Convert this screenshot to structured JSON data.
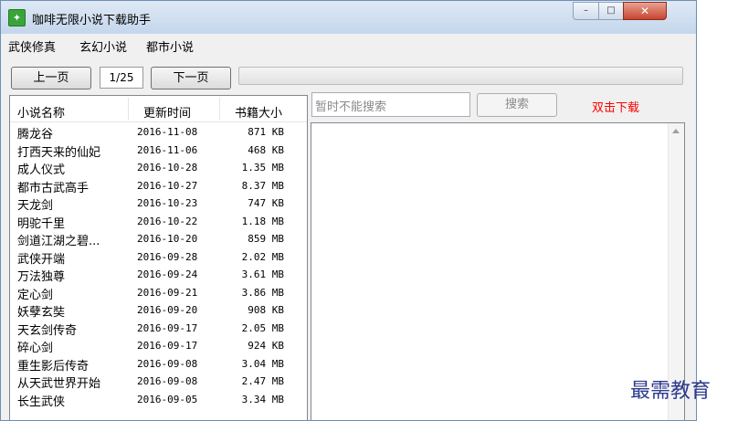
{
  "window": {
    "title": "咖啡无限小说下载助手",
    "min": "–",
    "max": "□",
    "close": "✕"
  },
  "menu": [
    "武侠修真",
    "玄幻小说",
    "都市小说"
  ],
  "toolbar": {
    "prev_label": "上一页",
    "page": "1/25",
    "next_label": "下一页",
    "progress_fraction": 0.0
  },
  "list": {
    "headers": {
      "name": "小说名称",
      "date": "更新时间",
      "size": "书籍大小"
    },
    "rows": [
      {
        "name": "腾龙谷",
        "date": "2016-11-08",
        "size": "871 KB"
      },
      {
        "name": "打西天来的仙妃",
        "date": "2016-11-06",
        "size": "468 KB"
      },
      {
        "name": "成人仪式",
        "date": "2016-10-28",
        "size": "1.35 MB"
      },
      {
        "name": "都市古武高手",
        "date": "2016-10-27",
        "size": "8.37 MB"
      },
      {
        "name": "天龙剑",
        "date": "2016-10-23",
        "size": "747 KB"
      },
      {
        "name": "明驼千里",
        "date": "2016-10-22",
        "size": "1.18 MB"
      },
      {
        "name": "剑道江湖之碧...",
        "date": "2016-10-20",
        "size": "859 MB"
      },
      {
        "name": "武侠开端",
        "date": "2016-09-28",
        "size": "2.02 MB"
      },
      {
        "name": "万法独尊",
        "date": "2016-09-24",
        "size": "3.61 MB"
      },
      {
        "name": "定心剑",
        "date": "2016-09-21",
        "size": "3.86 MB"
      },
      {
        "name": "妖孽玄奘",
        "date": "2016-09-20",
        "size": "908 KB"
      },
      {
        "name": "天玄剑传奇",
        "date": "2016-09-17",
        "size": "2.05 MB"
      },
      {
        "name": "碎心剑",
        "date": "2016-09-17",
        "size": "924 KB"
      },
      {
        "name": "重生影后传奇",
        "date": "2016-09-08",
        "size": "3.04 MB"
      },
      {
        "name": "从天武世界开始",
        "date": "2016-09-08",
        "size": "2.47 MB"
      },
      {
        "name": "长生武侠",
        "date": "2016-09-05",
        "size": "3.34 MB"
      }
    ]
  },
  "search": {
    "placeholder": "暂时不能搜索",
    "button_label": "搜索",
    "hint": "双击下载"
  },
  "watermark": "最需教育",
  "colors": {
    "hint": "#ff0000",
    "watermark": "#2d3a8c",
    "progress": "#06b025"
  }
}
